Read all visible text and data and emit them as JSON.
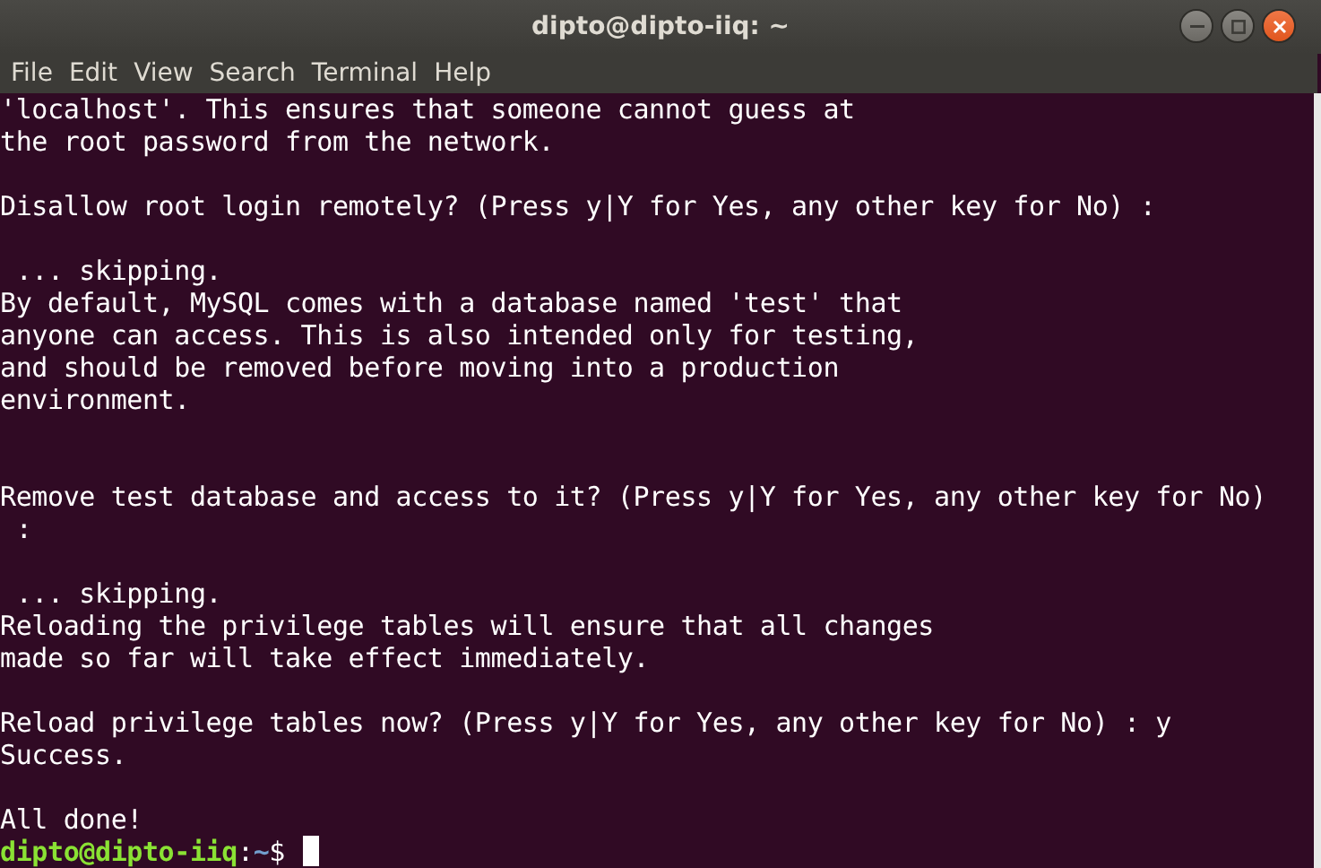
{
  "window": {
    "title": "dipto@dipto-iiq: ~"
  },
  "menu": [
    "File",
    "Edit",
    "View",
    "Search",
    "Terminal",
    "Help"
  ],
  "terminal": {
    "lines": [
      {
        "kind": "text",
        "text": "'localhost'. This ensures that someone cannot guess at"
      },
      {
        "kind": "text",
        "text": "the root password from the network."
      },
      {
        "kind": "blank"
      },
      {
        "kind": "text",
        "text": "Disallow root login remotely? (Press y|Y for Yes, any other key for No) :"
      },
      {
        "kind": "blank"
      },
      {
        "kind": "text",
        "text": " ... skipping."
      },
      {
        "kind": "text",
        "text": "By default, MySQL comes with a database named 'test' that"
      },
      {
        "kind": "text",
        "text": "anyone can access. This is also intended only for testing,"
      },
      {
        "kind": "text",
        "text": "and should be removed before moving into a production"
      },
      {
        "kind": "text",
        "text": "environment."
      },
      {
        "kind": "blank"
      },
      {
        "kind": "blank"
      },
      {
        "kind": "text",
        "text": "Remove test database and access to it? (Press y|Y for Yes, any other key for No)"
      },
      {
        "kind": "text",
        "text": " :"
      },
      {
        "kind": "blank"
      },
      {
        "kind": "text",
        "text": " ... skipping."
      },
      {
        "kind": "text",
        "text": "Reloading the privilege tables will ensure that all changes"
      },
      {
        "kind": "text",
        "text": "made so far will take effect immediately."
      },
      {
        "kind": "blank"
      },
      {
        "kind": "text",
        "text": "Reload privilege tables now? (Press y|Y for Yes, any other key for No) : y"
      },
      {
        "kind": "text",
        "text": "Success."
      },
      {
        "kind": "blank"
      },
      {
        "kind": "text",
        "text": "All done!"
      },
      {
        "kind": "prompt",
        "user_host": "dipto@dipto-iiq",
        "separator": ":",
        "path": "~",
        "symbol": "$"
      }
    ]
  }
}
